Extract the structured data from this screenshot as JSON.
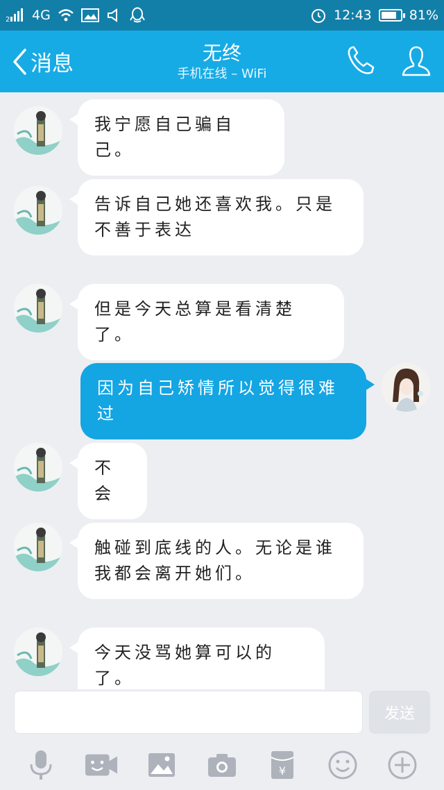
{
  "status_bar": {
    "network": "4G",
    "sim": "2",
    "time": "12:43",
    "battery": "81%",
    "battery_level": 0.81
  },
  "nav": {
    "back_label": "消息",
    "title": "无终",
    "subtitle": "手机在线 – WiFi"
  },
  "messages": [
    {
      "side": "in",
      "text": "我宁愿自己骗自己。"
    },
    {
      "side": "in",
      "text": "告诉自己她还喜欢我。只是不善于表达"
    },
    {
      "side": "in",
      "text": "但是今天总算是看清楚了。"
    },
    {
      "side": "out",
      "text": "因为自己矫情所以觉得很难过"
    },
    {
      "side": "in",
      "text": "不会"
    },
    {
      "side": "in",
      "text": "触碰到底线的人。无论是谁我都会离开她们。"
    },
    {
      "side": "in",
      "text": "今天没骂她算可以的了。"
    }
  ],
  "composer": {
    "input_value": "",
    "send_label": "发送"
  },
  "toolbar": [
    "mic-icon",
    "video-icon",
    "image-icon",
    "camera-icon",
    "red-packet-icon",
    "emoji-icon",
    "plus-icon"
  ],
  "colors": {
    "status_bar": "#127fa8",
    "nav_bar": "#17abe5",
    "outgoing_bubble": "#14a5e3",
    "background": "#eceef2",
    "icon_gray": "#aeb2bb"
  }
}
